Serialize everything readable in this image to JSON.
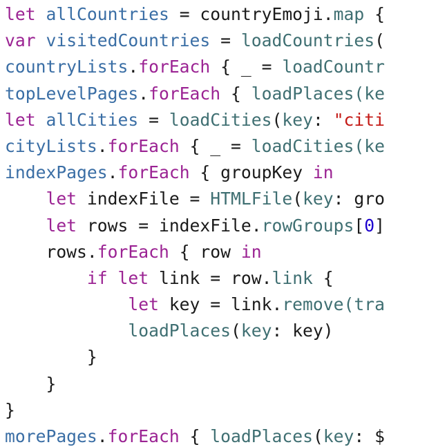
{
  "lines": [
    [
      {
        "t": "let",
        "c": "kw"
      },
      {
        "t": " ",
        "c": "plain"
      },
      {
        "t": "allCountries",
        "c": "ident"
      },
      {
        "t": " = countryEmoji.",
        "c": "plain"
      },
      {
        "t": "map",
        "c": "fn"
      },
      {
        "t": " {",
        "c": "plain"
      }
    ],
    [
      {
        "t": "var",
        "c": "kw"
      },
      {
        "t": " ",
        "c": "plain"
      },
      {
        "t": "visitedCountries",
        "c": "ident"
      },
      {
        "t": " = ",
        "c": "plain"
      },
      {
        "t": "loadCountries",
        "c": "fn"
      },
      {
        "t": "(",
        "c": "plain"
      }
    ],
    [
      {
        "t": "countryLists",
        "c": "ident"
      },
      {
        "t": ".",
        "c": "plain"
      },
      {
        "t": "forEach",
        "c": "kw"
      },
      {
        "t": " { _ = ",
        "c": "plain"
      },
      {
        "t": "loadCountr",
        "c": "fn"
      }
    ],
    [
      {
        "t": "topLevelPages",
        "c": "ident"
      },
      {
        "t": ".",
        "c": "plain"
      },
      {
        "t": "forEach",
        "c": "kw"
      },
      {
        "t": " { ",
        "c": "plain"
      },
      {
        "t": "loadPlaces",
        "c": "fn"
      },
      {
        "t": "(ke",
        "c": "fn"
      }
    ],
    [
      {
        "t": "let",
        "c": "kw"
      },
      {
        "t": " ",
        "c": "plain"
      },
      {
        "t": "allCities",
        "c": "ident"
      },
      {
        "t": " = ",
        "c": "plain"
      },
      {
        "t": "loadCities",
        "c": "fn"
      },
      {
        "t": "(",
        "c": "plain"
      },
      {
        "t": "key",
        "c": "fn"
      },
      {
        "t": ": ",
        "c": "plain"
      },
      {
        "t": "\"citi",
        "c": "str"
      }
    ],
    [
      {
        "t": "cityLists",
        "c": "ident"
      },
      {
        "t": ".",
        "c": "plain"
      },
      {
        "t": "forEach",
        "c": "kw"
      },
      {
        "t": " { _ = ",
        "c": "plain"
      },
      {
        "t": "loadCities",
        "c": "fn"
      },
      {
        "t": "(ke",
        "c": "fn"
      }
    ],
    [
      {
        "t": "indexPages",
        "c": "ident"
      },
      {
        "t": ".",
        "c": "plain"
      },
      {
        "t": "forEach",
        "c": "kw"
      },
      {
        "t": " { groupKey ",
        "c": "plain"
      },
      {
        "t": "in",
        "c": "kw"
      }
    ],
    [
      {
        "t": "    ",
        "c": "plain"
      },
      {
        "t": "let",
        "c": "kw"
      },
      {
        "t": " indexFile = ",
        "c": "plain"
      },
      {
        "t": "HTMLFile",
        "c": "fn"
      },
      {
        "t": "(",
        "c": "plain"
      },
      {
        "t": "key",
        "c": "fn"
      },
      {
        "t": ": gro",
        "c": "plain"
      }
    ],
    [
      {
        "t": "    ",
        "c": "plain"
      },
      {
        "t": "let",
        "c": "kw"
      },
      {
        "t": " rows = indexFile.",
        "c": "plain"
      },
      {
        "t": "rowGroups",
        "c": "fn"
      },
      {
        "t": "[",
        "c": "plain"
      },
      {
        "t": "0",
        "c": "num"
      },
      {
        "t": "]",
        "c": "plain"
      }
    ],
    [
      {
        "t": "    rows.",
        "c": "plain"
      },
      {
        "t": "forEach",
        "c": "kw"
      },
      {
        "t": " { row ",
        "c": "plain"
      },
      {
        "t": "in",
        "c": "kw"
      }
    ],
    [
      {
        "t": "        ",
        "c": "plain"
      },
      {
        "t": "if",
        "c": "kw"
      },
      {
        "t": " ",
        "c": "plain"
      },
      {
        "t": "let",
        "c": "kw"
      },
      {
        "t": " link = row.",
        "c": "plain"
      },
      {
        "t": "link",
        "c": "fn"
      },
      {
        "t": " {",
        "c": "plain"
      }
    ],
    [
      {
        "t": "            ",
        "c": "plain"
      },
      {
        "t": "let",
        "c": "kw"
      },
      {
        "t": " key = link.",
        "c": "plain"
      },
      {
        "t": "remove",
        "c": "fn"
      },
      {
        "t": "(tra",
        "c": "fn"
      }
    ],
    [
      {
        "t": "            ",
        "c": "plain"
      },
      {
        "t": "loadPlaces",
        "c": "fn"
      },
      {
        "t": "(",
        "c": "plain"
      },
      {
        "t": "key",
        "c": "fn"
      },
      {
        "t": ": key)",
        "c": "plain"
      }
    ],
    [
      {
        "t": "        }",
        "c": "plain"
      }
    ],
    [
      {
        "t": "    }",
        "c": "plain"
      }
    ],
    [
      {
        "t": "}",
        "c": "plain"
      }
    ],
    [
      {
        "t": "morePages",
        "c": "ident"
      },
      {
        "t": ".",
        "c": "plain"
      },
      {
        "t": "forEach",
        "c": "kw"
      },
      {
        "t": " { ",
        "c": "plain"
      },
      {
        "t": "loadPlaces",
        "c": "fn"
      },
      {
        "t": "(",
        "c": "plain"
      },
      {
        "t": "key",
        "c": "fn"
      },
      {
        "t": ": $",
        "c": "plain"
      }
    ]
  ]
}
